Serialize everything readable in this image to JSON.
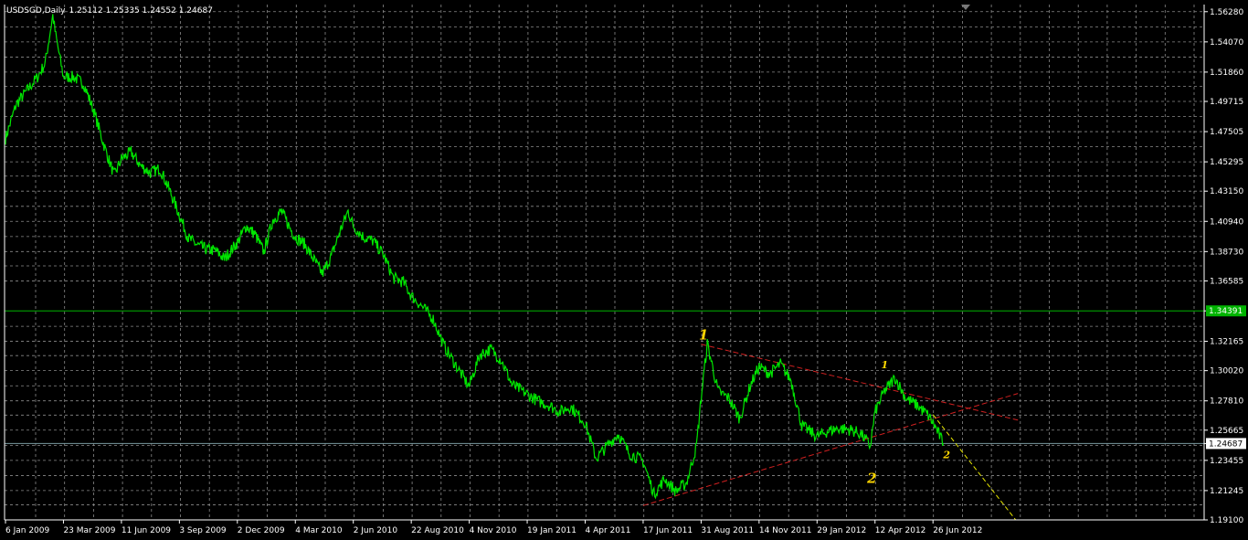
{
  "header": {
    "symbol": "USDSGD,Daily",
    "ohlc": "1.25112 1.25335 1.24552 1.24687"
  },
  "colors": {
    "background": "#000000",
    "grid": "#8a8a8a",
    "price_line": "#00e600",
    "hline_green": "#00b400",
    "hline_current": "#7a9aa0",
    "trendline": "#d02020",
    "projection": "#e8e800",
    "wave_label": "#ffd700"
  },
  "chart_data": {
    "type": "line",
    "title": "USDSGD,Daily",
    "y_ticks": [
      "1.56280",
      "1.54070",
      "1.51860",
      "1.49715",
      "1.47505",
      "1.45295",
      "1.43150",
      "1.40940",
      "1.38730",
      "1.36585",
      "1.34391",
      "1.32165",
      "1.30020",
      "1.27810",
      "1.25665",
      "1.24687",
      "1.23455",
      "1.21245",
      "1.19100"
    ],
    "x_ticks": [
      "6 Jan 2009",
      "23 Mar 2009",
      "11 Jun 2009",
      "3 Sep 2009",
      "2 Dec 2009",
      "4 Mar 2010",
      "2 Jun 2010",
      "22 Aug 2010",
      "4 Nov 2010",
      "19 Jan 2011",
      "4 Apr 2011",
      "17 Jun 2011",
      "31 Aug 2011",
      "14 Nov 2011",
      "29 Jan 2012",
      "12 Apr 2012",
      "26 Jun 2012"
    ],
    "ylim": [
      1.191,
      1.568
    ],
    "series": [
      {
        "points": [
          [
            "6 Jan 2009",
            1.47
          ],
          [
            "20 Jan 2009",
            1.495
          ],
          [
            "3 Feb 2009",
            1.505
          ],
          [
            "17 Feb 2009",
            1.515
          ],
          [
            "27 Feb 2009",
            1.525
          ],
          [
            "9 Mar 2009",
            1.56
          ],
          [
            "13 Mar 2009",
            1.545
          ],
          [
            "23 Mar 2009",
            1.515
          ],
          [
            "6 Apr 2009",
            1.515
          ],
          [
            "20 Apr 2009",
            1.51
          ],
          [
            "4 May 2009",
            1.49
          ],
          [
            "18 May 2009",
            1.465
          ],
          [
            "1 Jun 2009",
            1.443
          ],
          [
            "11 Jun 2009",
            1.455
          ],
          [
            "25 Jun 2009",
            1.46
          ],
          [
            "9 Jul 2009",
            1.45
          ],
          [
            "23 Jul 2009",
            1.445
          ],
          [
            "6 Aug 2009",
            1.448
          ],
          [
            "20 Aug 2009",
            1.432
          ],
          [
            "3 Sep 2009",
            1.414
          ],
          [
            "17 Sep 2009",
            1.397
          ],
          [
            "1 Oct 2009",
            1.392
          ],
          [
            "15 Oct 2009",
            1.389
          ],
          [
            "29 Oct 2009",
            1.388
          ],
          [
            "12 Nov 2009",
            1.382
          ],
          [
            "2 Dec 2009",
            1.394
          ],
          [
            "16 Dec 2009",
            1.406
          ],
          [
            "30 Dec 2009",
            1.4
          ],
          [
            "13 Jan 2010",
            1.387
          ],
          [
            "27 Jan 2010",
            1.41
          ],
          [
            "10 Feb 2010",
            1.417
          ],
          [
            "24 Feb 2010",
            1.404
          ],
          [
            "4 Mar 2010",
            1.398
          ],
          [
            "18 Mar 2010",
            1.393
          ],
          [
            "1 Apr 2010",
            1.382
          ],
          [
            "15 Apr 2010",
            1.371
          ],
          [
            "29 Apr 2010",
            1.384
          ],
          [
            "13 May 2010",
            1.403
          ],
          [
            "25 May 2010",
            1.417
          ],
          [
            "2 Jun 2010",
            1.406
          ],
          [
            "16 Jun 2010",
            1.398
          ],
          [
            "30 Jun 2010",
            1.395
          ],
          [
            "14 Jul 2010",
            1.385
          ],
          [
            "28 Jul 2010",
            1.368
          ],
          [
            "11 Aug 2010",
            1.365
          ],
          [
            "22 Aug 2010",
            1.355
          ],
          [
            "5 Sep 2010",
            1.347
          ],
          [
            "19 Sep 2010",
            1.338
          ],
          [
            "3 Oct 2010",
            1.318
          ],
          [
            "17 Oct 2010",
            1.305
          ],
          [
            "31 Oct 2010",
            1.292
          ],
          [
            "4 Nov 2010",
            1.289
          ],
          [
            "18 Nov 2010",
            1.312
          ],
          [
            "2 Dec 2010",
            1.316
          ],
          [
            "16 Dec 2010",
            1.308
          ],
          [
            "30 Dec 2010",
            1.29
          ],
          [
            "19 Jan 2011",
            1.283
          ],
          [
            "2 Feb 2011",
            1.278
          ],
          [
            "16 Feb 2011",
            1.275
          ],
          [
            "2 Mar 2011",
            1.27
          ],
          [
            "16 Mar 2011",
            1.274
          ],
          [
            "4 Apr 2011",
            1.262
          ],
          [
            "18 Apr 2011",
            1.236
          ],
          [
            "2 May 2011",
            1.245
          ],
          [
            "16 May 2011",
            1.254
          ],
          [
            "30 May 2011",
            1.24
          ],
          [
            "17 Jun 2011",
            1.234
          ],
          [
            "1 Jul 2011",
            1.21
          ],
          [
            "15 Jul 2011",
            1.221
          ],
          [
            "29 Jul 2011",
            1.212
          ],
          [
            "12 Aug 2011",
            1.218
          ],
          [
            "25 Aug 2011",
            1.245
          ],
          [
            "31 Aug 2011",
            1.28
          ],
          [
            "8 Sep 2011",
            1.32
          ],
          [
            "22 Sep 2011",
            1.285
          ],
          [
            "6 Oct 2011",
            1.28
          ],
          [
            "20 Oct 2011",
            1.265
          ],
          [
            "3 Nov 2011",
            1.29
          ],
          [
            "14 Nov 2011",
            1.303
          ],
          [
            "28 Nov 2011",
            1.298
          ],
          [
            "12 Dec 2011",
            1.305
          ],
          [
            "26 Dec 2011",
            1.293
          ],
          [
            "9 Jan 2012",
            1.26
          ],
          [
            "29 Jan 2012",
            1.252
          ],
          [
            "12 Feb 2012",
            1.256
          ],
          [
            "26 Feb 2012",
            1.258
          ],
          [
            "11 Mar 2012",
            1.257
          ],
          [
            "25 Mar 2012",
            1.254
          ],
          [
            "6 Apr 2012",
            1.245
          ],
          [
            "12 Apr 2012",
            1.27
          ],
          [
            "24 Apr 2012",
            1.285
          ],
          [
            "8 May 2012",
            1.295
          ],
          [
            "22 May 2012",
            1.28
          ],
          [
            "5 Jun 2012",
            1.275
          ],
          [
            "19 Jun 2012",
            1.268
          ],
          [
            "26 Jun 2012",
            1.262
          ],
          [
            "3 Jul 2012",
            1.255
          ],
          [
            "10 Jul 2012",
            1.247
          ]
        ]
      }
    ],
    "horizontal_lines": [
      {
        "label": "1.34391",
        "value": 1.34391
      },
      {
        "label": "1.24687",
        "value": 1.24687
      }
    ],
    "trendlines": [
      {
        "from": [
          "31 Aug 2011",
          1.3195
        ],
        "to": [
          "20 Oct 2012",
          1.264
        ]
      },
      {
        "from": [
          "17 Jun 2011",
          1.2015
        ],
        "to": [
          "20 Oct 2012",
          1.2835
        ]
      }
    ],
    "projection": {
      "from": [
        "26 Jun 2012",
        1.268
      ],
      "to": [
        "17 Oct 2012",
        1.191
      ]
    },
    "annotations": [
      {
        "text": "1",
        "at": [
          "28 Aug 2011",
          1.323
        ]
      },
      {
        "text": "1",
        "at": [
          "20 Apr 2012",
          1.302
        ]
      },
      {
        "text": "2",
        "at": [
          "10 Jul 2012",
          1.236
        ]
      },
      {
        "text": "2",
        "at": [
          "2 Apr 2012",
          1.218
        ]
      }
    ],
    "grid": true
  }
}
